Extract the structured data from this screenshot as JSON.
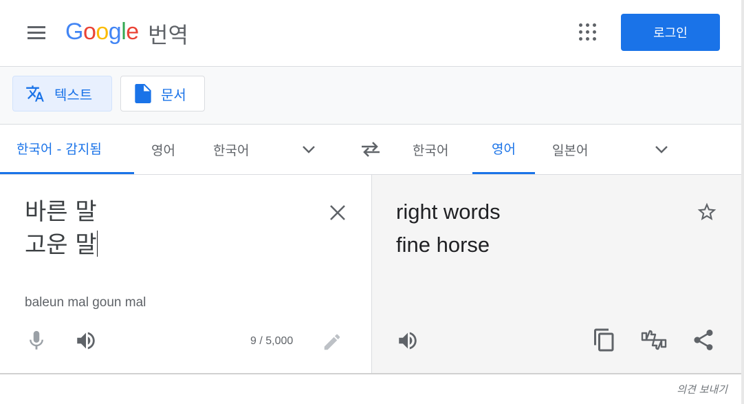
{
  "header": {
    "logo_letters": [
      "G",
      "o",
      "o",
      "g",
      "l",
      "e"
    ],
    "product_name": "번역",
    "login_label": "로그인",
    "menu_icon": "hamburger-menu-icon",
    "apps_icon": "apps-grid-icon"
  },
  "modes": [
    {
      "label": "텍스트",
      "icon": "translate-icon",
      "active": true
    },
    {
      "label": "문서",
      "icon": "document-icon",
      "active": false
    }
  ],
  "source_langs": {
    "tabs": [
      {
        "label": "한국어 - 감지됨",
        "active": true
      },
      {
        "label": "영어",
        "active": false
      },
      {
        "label": "한국어",
        "active": false
      }
    ]
  },
  "target_langs": {
    "tabs": [
      {
        "label": "한국어",
        "active": false
      },
      {
        "label": "영어",
        "active": true
      },
      {
        "label": "일본어",
        "active": false
      }
    ]
  },
  "source": {
    "line1": "바른 말",
    "line2": "고운 말",
    "romanization": "baleun mal goun mal",
    "counter": "9 / 5,000"
  },
  "target": {
    "line1": "right words",
    "line2": "fine horse"
  },
  "footer": {
    "feedback_label": "의견 보내기"
  },
  "colors": {
    "accent": "#1a73e8",
    "text": "#3c4043",
    "muted": "#5f6368",
    "target_bg": "#f5f5f5"
  }
}
